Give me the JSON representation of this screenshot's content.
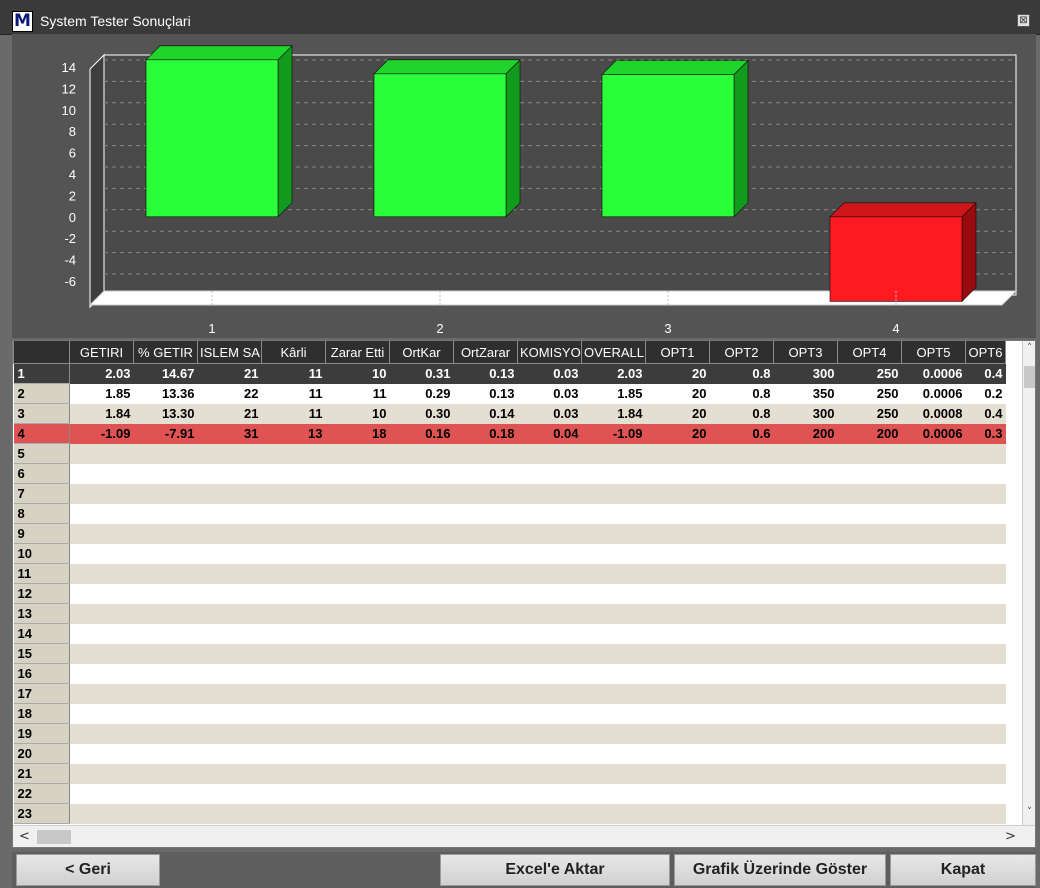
{
  "window": {
    "title": "System Tester Sonuçlari",
    "logo": "M",
    "close_glyph": "⊠"
  },
  "chart_data": {
    "type": "bar",
    "categories": [
      "1",
      "2",
      "3",
      "4"
    ],
    "values": [
      14.67,
      13.36,
      13.3,
      -7.91
    ],
    "yticks": [
      14,
      12,
      10,
      8,
      6,
      4,
      2,
      0,
      -2,
      -4,
      -6
    ],
    "ylim": [
      -6,
      14
    ],
    "grid": true,
    "colors": {
      "positive": "#2aff3a",
      "negative": "#ff1a22"
    }
  },
  "table": {
    "columns": [
      "GETIRI",
      "% GETIR",
      "ISLEM SA",
      "Kârli",
      "Zarar Etti",
      "OrtKar",
      "OrtZarar",
      "KOMISYO",
      "OVERALL",
      "OPT1",
      "OPT2",
      "OPT3",
      "OPT4",
      "OPT5",
      "OPT6"
    ],
    "rows": [
      {
        "num": "1",
        "cells": [
          "2.03",
          "14.67",
          "21",
          "11",
          "10",
          "0.31",
          "0.13",
          "0.03",
          "2.03",
          "20",
          "0.8",
          "300",
          "250",
          "0.0006",
          "0.4"
        ]
      },
      {
        "num": "2",
        "cells": [
          "1.85",
          "13.36",
          "22",
          "11",
          "11",
          "0.29",
          "0.13",
          "0.03",
          "1.85",
          "20",
          "0.8",
          "350",
          "250",
          "0.0006",
          "0.2"
        ]
      },
      {
        "num": "3",
        "cells": [
          "1.84",
          "13.30",
          "21",
          "11",
          "10",
          "0.30",
          "0.14",
          "0.03",
          "1.84",
          "20",
          "0.8",
          "300",
          "250",
          "0.0008",
          "0.4"
        ]
      },
      {
        "num": "4",
        "cells": [
          "-1.09",
          "-7.91",
          "31",
          "13",
          "18",
          "0.16",
          "0.18",
          "0.04",
          "-1.09",
          "20",
          "0.6",
          "200",
          "200",
          "0.0006",
          "0.3"
        ]
      }
    ],
    "empty_row_numbers": [
      "5",
      "6",
      "7",
      "8",
      "9",
      "10",
      "11",
      "12",
      "13",
      "14",
      "15",
      "16",
      "17",
      "18",
      "19",
      "20",
      "21",
      "22",
      "23"
    ],
    "selected_row": "1",
    "negative_row": "4"
  },
  "scroll": {
    "up": "˄",
    "down": "˅",
    "left": "<",
    "right": ">"
  },
  "buttons": {
    "back": "< Geri",
    "excel": "Excel'e Aktar",
    "show_on_chart": "Grafik Üzerinde Göster",
    "close": "Kapat"
  }
}
